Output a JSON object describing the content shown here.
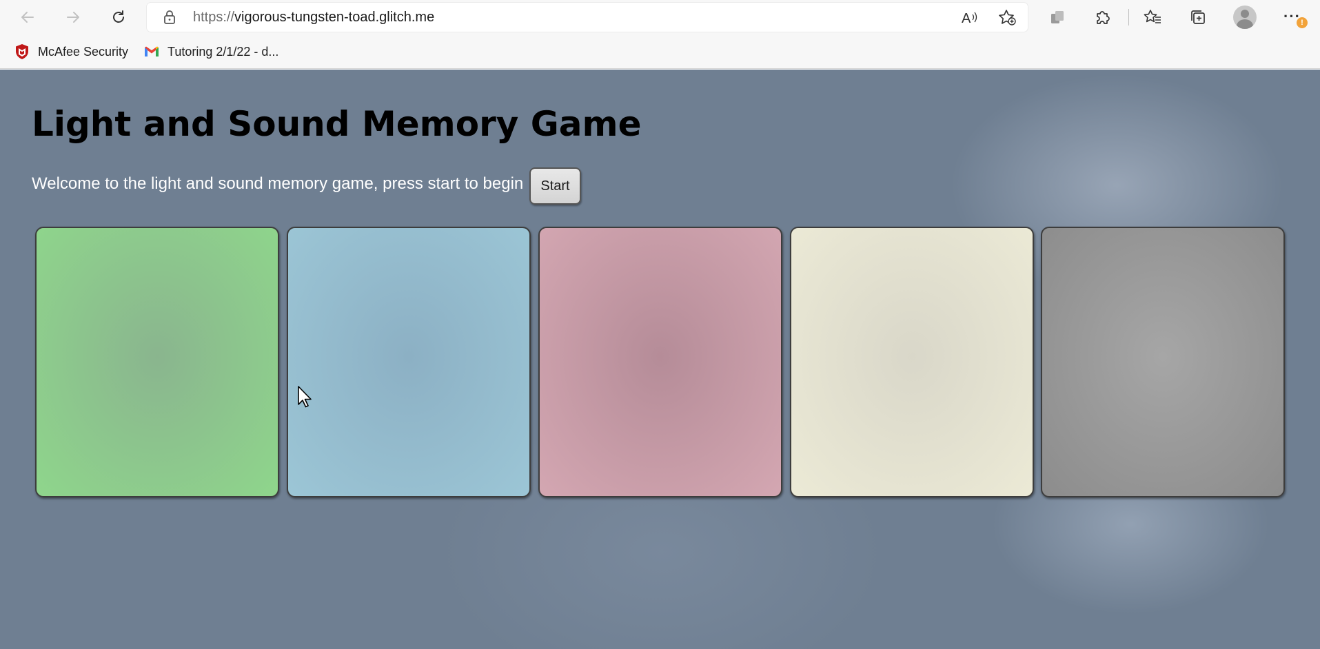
{
  "browser": {
    "url_scheme": "https://",
    "url_host": "vigorous-tungsten-toad.glitch.me",
    "read_aloud_label": "A",
    "more_menu_glyph": "···",
    "update_badge": "!",
    "bookmarks": [
      {
        "label": "McAfee Security",
        "icon": "mcafee-shield-icon"
      },
      {
        "label": "Tutoring 2/1/22 - d...",
        "icon": "gmail-icon"
      }
    ],
    "toolbar_icons": [
      "back-arrow-icon",
      "forward-arrow-icon",
      "refresh-icon",
      "lock-icon",
      "read-aloud-icon",
      "add-favorite-icon",
      "copy-icon",
      "extensions-puzzle-icon",
      "favorites-icon",
      "collections-icon",
      "profile-avatar-icon",
      "more-icon"
    ]
  },
  "page": {
    "title": "Light and Sound Memory Game",
    "intro": "Welcome to the light and sound memory game, press start to begin",
    "start_label": "Start"
  },
  "pads": [
    {
      "color_center": "#8ab58e",
      "color_edge": "#8fd68c"
    },
    {
      "color_center": "#8cb0c4",
      "color_edge": "#9cc6d6"
    },
    {
      "color_center": "#b58c98",
      "color_edge": "#d4a7b2"
    },
    {
      "color_center": "#d9d7c9",
      "color_edge": "#ecead6"
    },
    {
      "color_center": "#a6a6a6",
      "color_edge": "#8c8c8c"
    }
  ],
  "colors": {
    "page_background": "#6f7f92",
    "chrome_background": "#f7f7f7",
    "notification_badge": "#f2a33a"
  }
}
